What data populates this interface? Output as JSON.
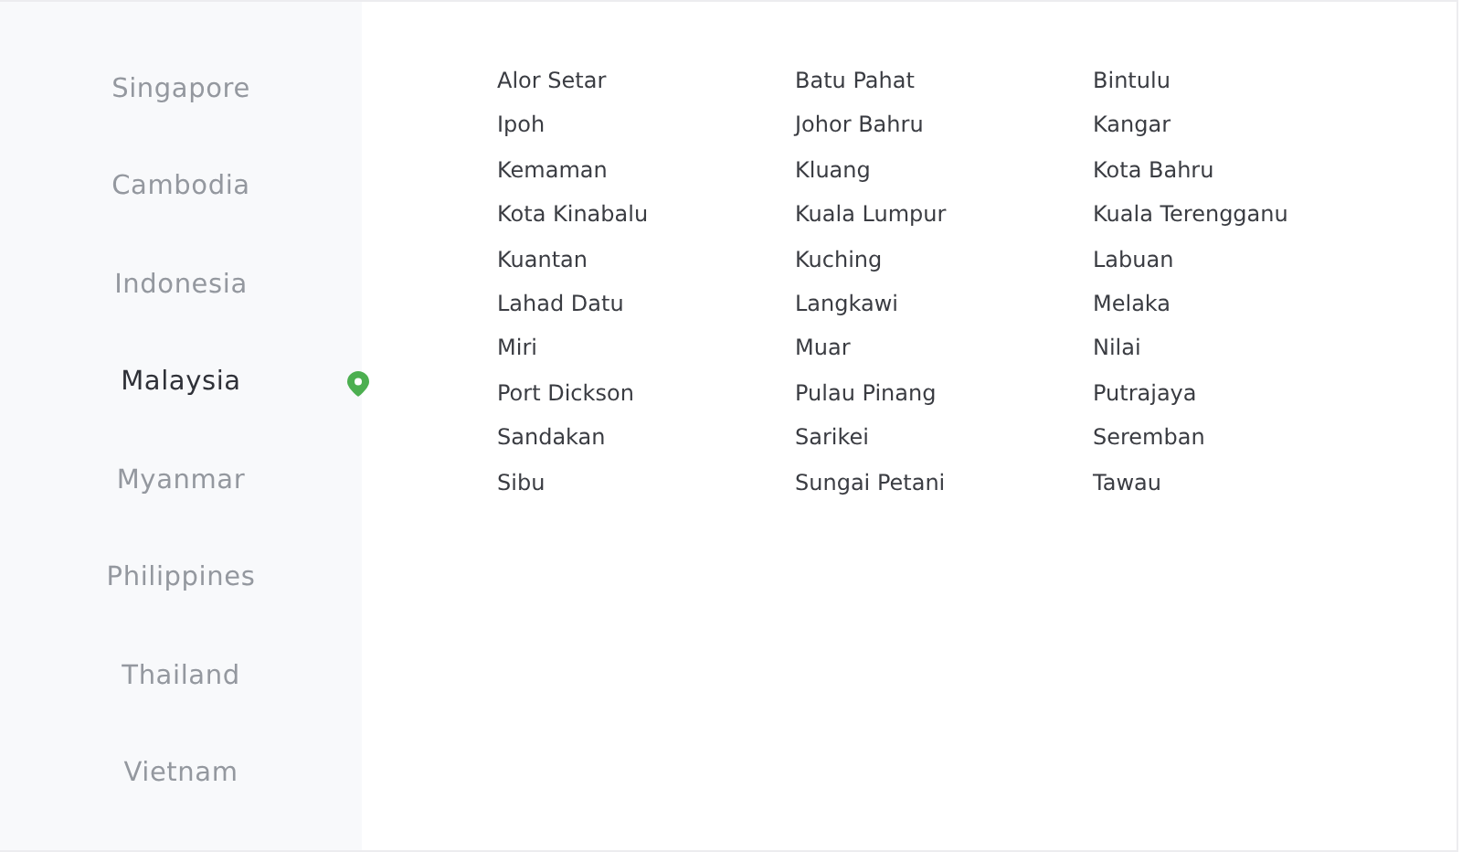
{
  "countries": [
    {
      "name": "Singapore",
      "selected": false
    },
    {
      "name": "Cambodia",
      "selected": false
    },
    {
      "name": "Indonesia",
      "selected": false
    },
    {
      "name": "Malaysia",
      "selected": true
    },
    {
      "name": "Myanmar",
      "selected": false
    },
    {
      "name": "Philippines",
      "selected": false
    },
    {
      "name": "Thailand",
      "selected": false
    },
    {
      "name": "Vietnam",
      "selected": false
    }
  ],
  "cities": [
    "Alor Setar",
    "Batu Pahat",
    "Bintulu",
    "Ipoh",
    "Johor Bahru",
    "Kangar",
    "Kemaman",
    "Kluang",
    "Kota Bahru",
    "Kota Kinabalu",
    "Kuala Lumpur",
    "Kuala Terengganu",
    "Kuantan",
    "Kuching",
    "Labuan",
    "Lahad Datu",
    "Langkawi",
    "Melaka",
    "Miri",
    "Muar",
    "Nilai",
    "Port Dickson",
    "Pulau Pinang",
    "Putrajaya",
    "Sandakan",
    "Sarikei",
    "Seremban",
    "Sibu",
    "Sungai Petani",
    "Tawau"
  ]
}
